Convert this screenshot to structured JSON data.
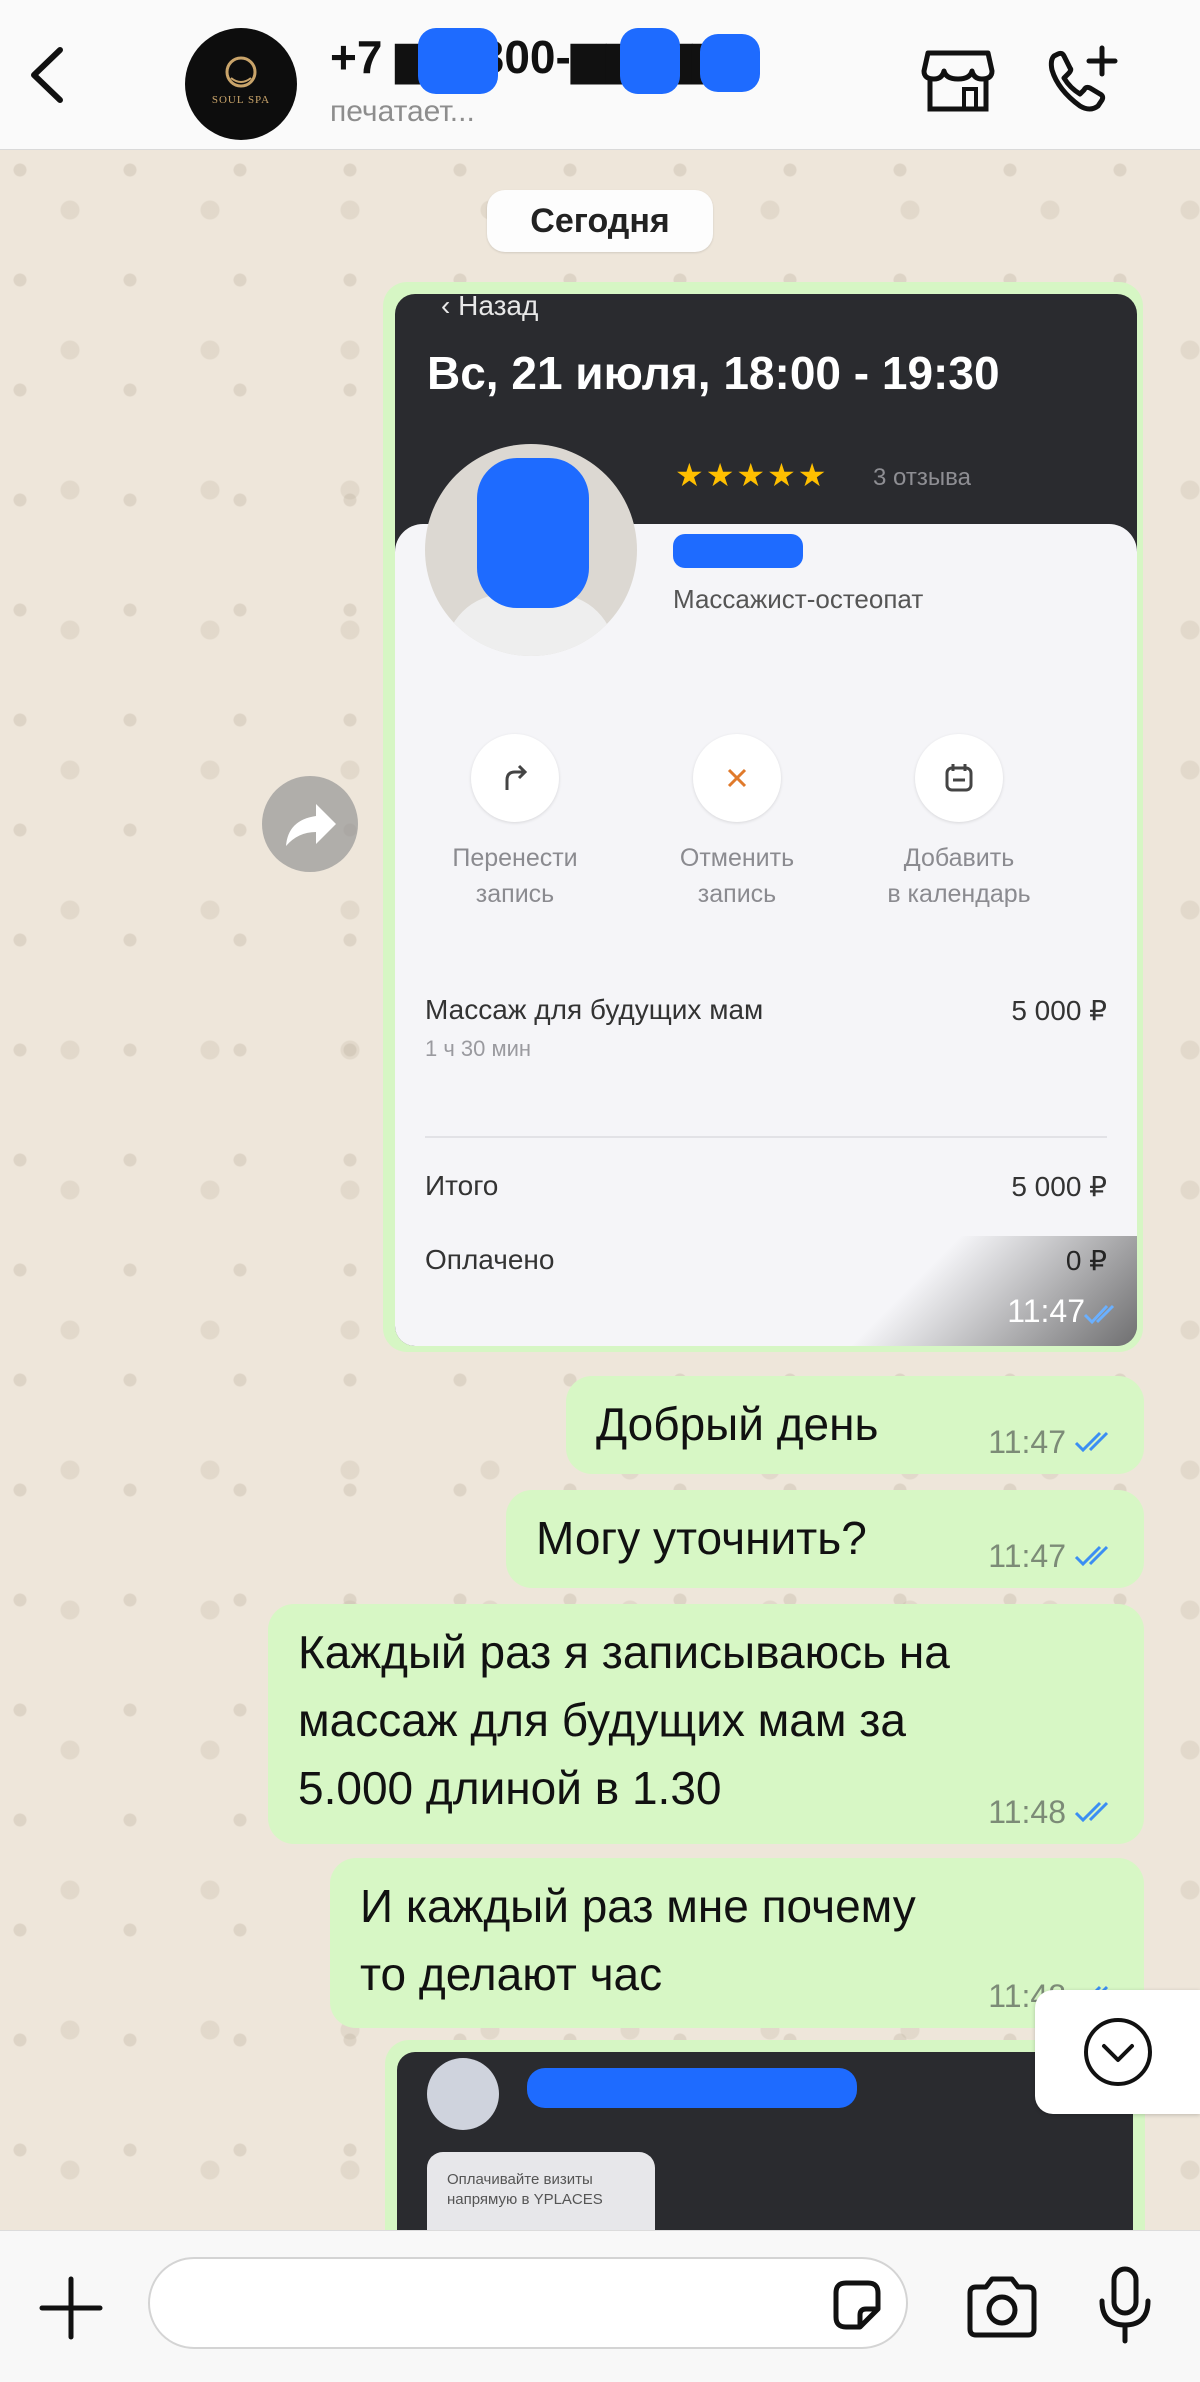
{
  "header": {
    "contact_name": "+7 ▆▆ 300-▆▆-▆▆",
    "status": "печатает...",
    "avatar_logo": "SOUL SPA"
  },
  "chat": {
    "date_chip": "Сегодня",
    "forwarded_screenshot": {
      "back_label": "Назад",
      "title": "Вс, 21 июля, 18:00 - 19:30",
      "stars": "★★★★★",
      "reviews": "3 отзыва",
      "master_role": "Массажист-остеопат",
      "actions": [
        {
          "label": "Перенести\nзапись",
          "icon": "reschedule-icon"
        },
        {
          "label": "Отменить\nзапись",
          "icon": "cancel-icon"
        },
        {
          "label": "Добавить\nв календарь",
          "icon": "calendar-icon"
        }
      ],
      "service_name": "Массаж для будущих мам",
      "service_duration": "1 ч 30 мин",
      "service_price": "5 000 ₽",
      "total_label": "Итого",
      "total_value": "5 000 ₽",
      "paid_label": "Оплачено",
      "paid_value": "0 ₽",
      "time": "11:47"
    },
    "messages": [
      {
        "text": "Добрый день",
        "time": "11:47"
      },
      {
        "text": "Могу уточнить?",
        "time": "11:47"
      },
      {
        "text": "Каждый раз я записываюсь на массаж для будущих мам за 5.000 длиной в 1.30",
        "time": "11:48"
      },
      {
        "text": "И каждый раз мне почему то делают час",
        "time": "11:48"
      }
    ],
    "second_screenshot": {
      "card_text": "Оплачивайте визиты напрямую в YPLACES"
    }
  },
  "input": {
    "placeholder": ""
  },
  "colors": {
    "bubble_out": "#d7f7c5",
    "read_check": "#3b8ef3",
    "redaction": "#1e6bff"
  }
}
